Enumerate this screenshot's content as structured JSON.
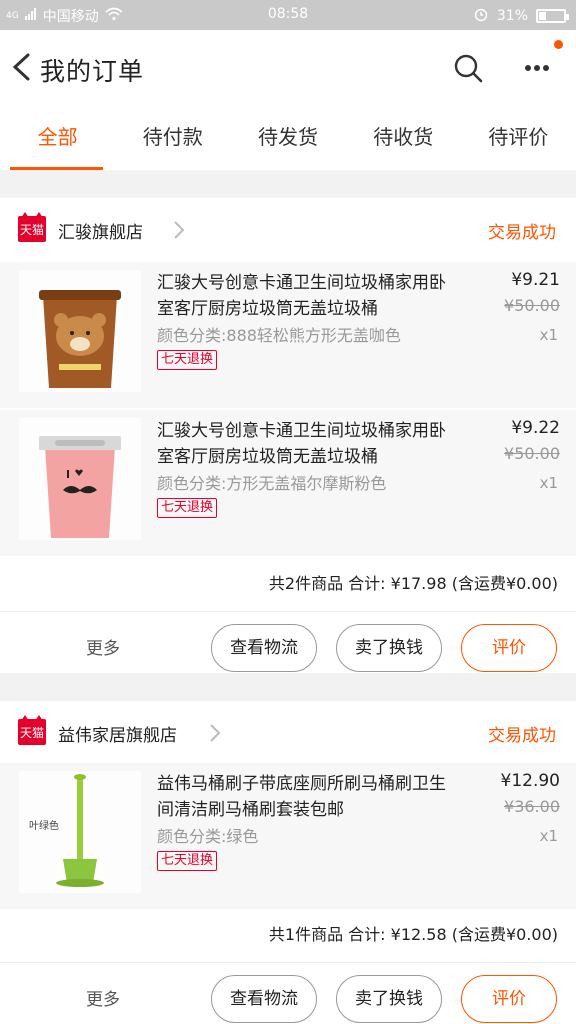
{
  "status_bar": {
    "network": "4G",
    "carrier": "中国移动",
    "time": "08:58",
    "battery": "31%",
    "battery_fraction": 0.31
  },
  "header": {
    "title": "我的订单",
    "icons": [
      "back-icon",
      "search-icon",
      "more-icon"
    ],
    "accent_color": "#ff5500"
  },
  "tabs": [
    {
      "label": "全部",
      "active": true
    },
    {
      "label": "待付款",
      "active": false
    },
    {
      "label": "待发货",
      "active": false
    },
    {
      "label": "待收货",
      "active": false
    },
    {
      "label": "待评价",
      "active": false
    }
  ],
  "orders": [
    {
      "store_badge": "天猫",
      "store_name": "汇骏旗舰店",
      "status": "交易成功",
      "items": [
        {
          "name": "汇骏大号创意卡通卫生间垃圾桶家用卧室客厅厨房垃圾筒无盖垃圾桶",
          "sku": "颜色分类:888轻松熊方形无盖咖色",
          "badge": "七天退换",
          "price": "¥9.21",
          "original_price": "¥50.00",
          "quantity": "x1"
        },
        {
          "name": "汇骏大号创意卡通卫生间垃圾桶家用卧室客厅厨房垃圾筒无盖垃圾桶",
          "sku": "颜色分类:方形无盖福尔摩斯粉色",
          "badge": "七天退换",
          "price": "¥9.22",
          "original_price": "¥50.00",
          "quantity": "x1"
        }
      ],
      "summary": "共2件商品 合计: ¥17.98 (含运费¥0.00)",
      "actions": {
        "more": "更多",
        "logistics": "查看物流",
        "resell": "卖了换钱",
        "review": "评价"
      }
    },
    {
      "store_badge": "天猫",
      "store_name": "益伟家居旗舰店",
      "status": "交易成功",
      "items": [
        {
          "name": "益伟马桶刷子带底座厕所刷马桶刷卫生间清洁刷马桶刷套装包邮",
          "sku": "颜色分类:绿色",
          "badge": "七天退换",
          "price": "¥12.90",
          "original_price": "¥36.00",
          "quantity": "x1",
          "image_label": "叶绿色"
        }
      ],
      "summary": "共1件商品 合计: ¥12.58 (含运费¥0.00)",
      "actions": {
        "more": "更多",
        "logistics": "查看物流",
        "resell": "卖了换钱",
        "review": "评价"
      }
    }
  ]
}
